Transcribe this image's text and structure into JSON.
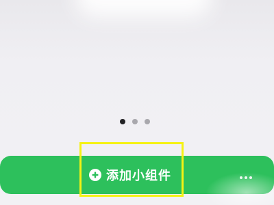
{
  "pager": {
    "total_pages": 3,
    "current_page": 1
  },
  "add_widget": {
    "label": "添加小组件",
    "icon": "plus-circle-icon"
  },
  "highlight": {
    "color": "#f5f213"
  },
  "colors": {
    "button_green": "#2dc05c",
    "background": "#efeef1"
  }
}
